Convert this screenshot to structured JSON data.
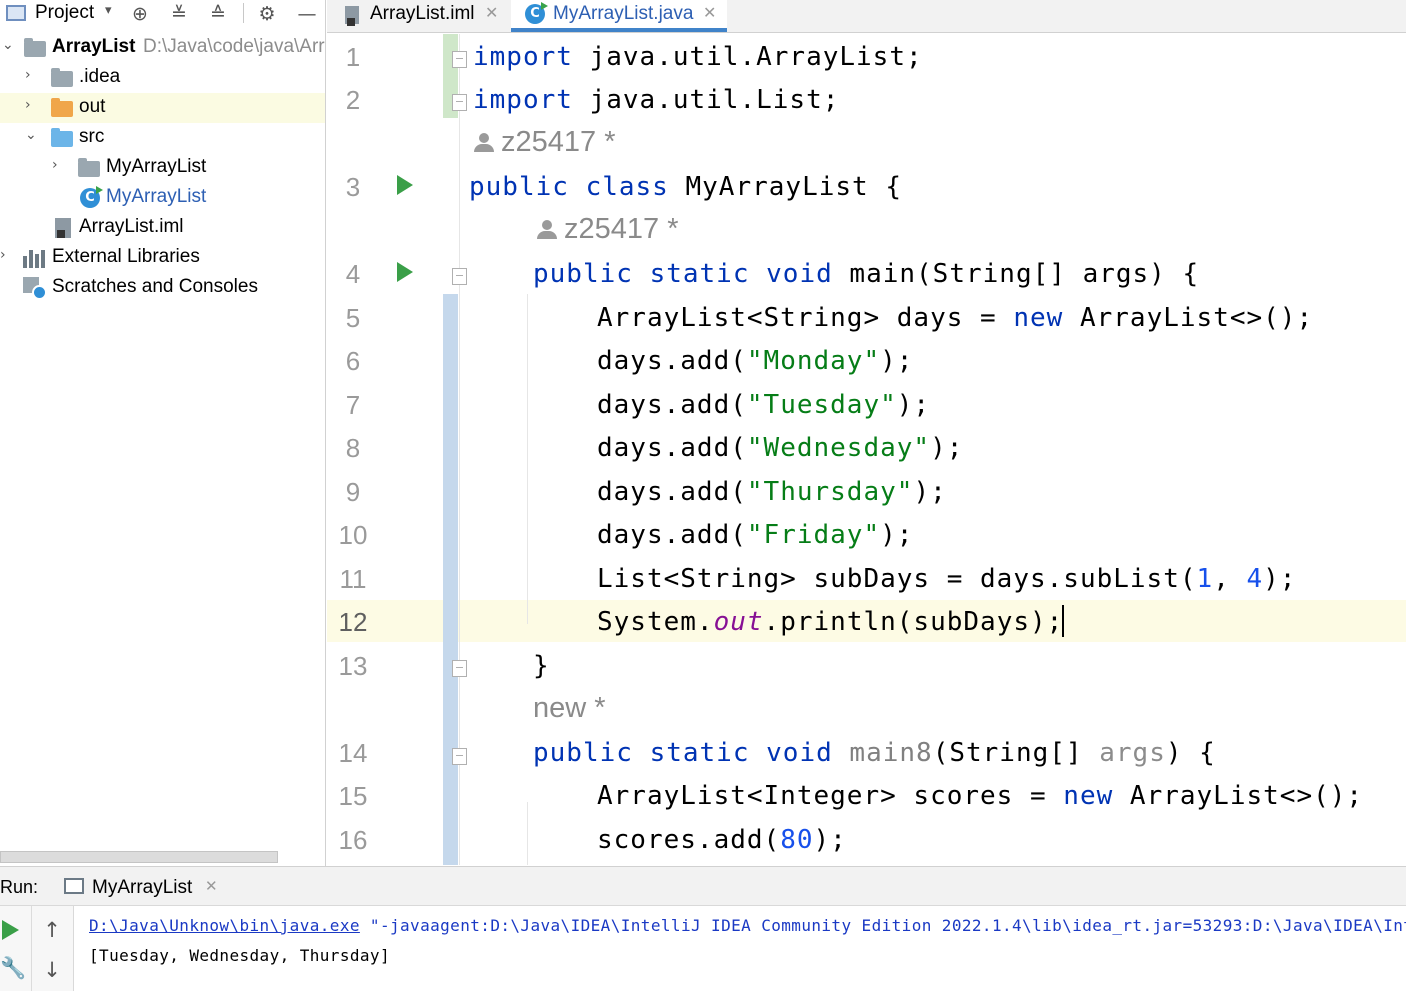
{
  "sidebar": {
    "title": "Project",
    "tree": [
      {
        "label": "ArrayList",
        "path": "D:\\Java\\code\\java\\Arr"
      },
      {
        "label": ".idea"
      },
      {
        "label": "out"
      },
      {
        "label": "src"
      },
      {
        "label": "MyArrayList"
      },
      {
        "label": "MyArrayList"
      },
      {
        "label": "ArrayList.iml"
      },
      {
        "label": "External Libraries"
      },
      {
        "label": "Scratches and Consoles"
      }
    ],
    "toolbar_icons": [
      "crosshair-icon",
      "expand-all-icon",
      "collapse-all-icon",
      "gear-icon",
      "minimize-icon"
    ]
  },
  "tabs": [
    {
      "label": "ArrayList.iml",
      "active": false
    },
    {
      "label": "MyArrayList.java",
      "active": true
    }
  ],
  "editor": {
    "line_numbers": [
      "1",
      "2",
      "3",
      "4",
      "5",
      "6",
      "7",
      "8",
      "9",
      "10",
      "11",
      "12",
      "13",
      "14",
      "15",
      "16"
    ],
    "current_line": "12",
    "author_hints": [
      "z25417 *",
      "z25417 *",
      "new *"
    ],
    "lines": {
      "l1": {
        "kw": "import",
        "rest": " java.util.ArrayList;"
      },
      "l2": {
        "kw": "import",
        "rest": " java.util.List;"
      },
      "l3": {
        "kw": "public class",
        "rest": " MyArrayList {"
      },
      "l4": {
        "kw": "public static void",
        "rest": " main(String[] args) {"
      },
      "l5": {
        "a": "ArrayList<String> days = ",
        "kw": "new",
        "b": " ArrayList<>();"
      },
      "l6": {
        "a": "days.add(",
        "str": "\"Monday\"",
        "b": ");"
      },
      "l7": {
        "a": "days.add(",
        "str": "\"Tuesday\"",
        "b": ");"
      },
      "l8": {
        "a": "days.add(",
        "str": "\"Wednesday\"",
        "b": ");"
      },
      "l9": {
        "a": "days.add(",
        "str": "\"Thursday\"",
        "b": ");"
      },
      "l10": {
        "a": "days.add(",
        "str": "\"Friday\"",
        "b": ");"
      },
      "l11": {
        "a": "List<String> subDays = days.subList(",
        "n1": "1",
        "c": ", ",
        "n2": "4",
        "b": ");"
      },
      "l12": {
        "a": "System.",
        "fld": "out",
        "b": ".println(subDays);"
      },
      "l13": {
        "a": "}"
      },
      "l14": {
        "kw": "public static void",
        "m": " main8",
        "a": "(String[] ",
        "par": "args",
        "b": ") {"
      },
      "l15": {
        "a": "ArrayList<Integer> scores = ",
        "kw": "new",
        "b": " ArrayList<>();"
      },
      "l16": {
        "a": "scores.add(",
        "num": "80",
        "b": ");"
      }
    }
  },
  "run_panel": {
    "label": "Run:",
    "tab_label": "MyArrayList",
    "command_link": "D:\\Java\\Unknow\\bin\\java.exe",
    "command_rest": " \"-javaagent:D:\\Java\\IDEA\\IntelliJ IDEA Community Edition 2022.1.4\\lib\\idea_rt.jar=53293:D:\\Java\\IDEA\\Int",
    "output": "[Tuesday, Wednesday, Thursday]",
    "tool_icons": [
      "run-icon",
      "arrow-up-icon",
      "wrench-icon",
      "arrow-down-icon"
    ]
  },
  "colors": {
    "keyword": "#0033b3",
    "string": "#067d17",
    "number": "#1750eb",
    "static_field": "#871094",
    "active_tab_underline": "#4083c9",
    "run_green": "#3a9f48",
    "caret_line": "#fdfbe4"
  }
}
